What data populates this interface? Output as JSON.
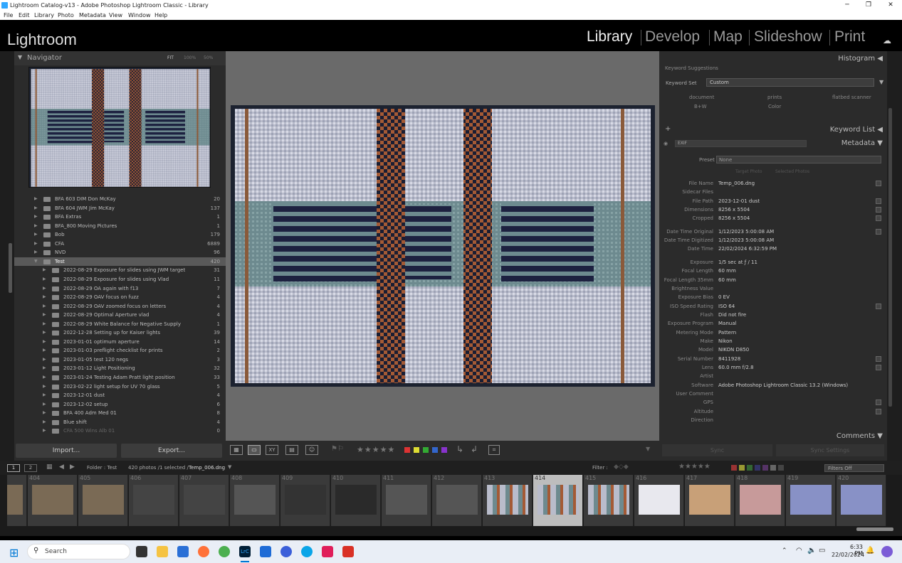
{
  "window": {
    "title": "Lightroom Catalog-v13 - Adobe Photoshop Lightroom Classic - Library"
  },
  "menu": [
    "File",
    "Edit",
    "Library",
    "Photo",
    "Metadata",
    "View",
    "Window",
    "Help"
  ],
  "app": {
    "logo": "Lightroom",
    "modules": [
      "Library",
      "Develop",
      "Map",
      "Slideshow",
      "Print"
    ],
    "active_module": "Library"
  },
  "navigator": {
    "title": "Navigator",
    "zoom_options": [
      "FIT",
      "100%",
      "50%"
    ]
  },
  "folders": [
    {
      "name": "BFA 603 DIM Don McKay",
      "count": "20",
      "level": 1
    },
    {
      "name": "BFA 604 JWM Jim McKay",
      "count": "137",
      "level": 1
    },
    {
      "name": "BFA Extras",
      "count": "1",
      "level": 1
    },
    {
      "name": "BFA_800 Moving Pictures",
      "count": "1",
      "level": 1
    },
    {
      "name": "Bob",
      "count": "179",
      "level": 1
    },
    {
      "name": "CFA",
      "count": "6889",
      "level": 1
    },
    {
      "name": "NVD",
      "count": "96",
      "level": 1
    },
    {
      "name": "Test",
      "count": "420",
      "level": 1,
      "selected": true
    },
    {
      "name": "2022-08-29 Exposure for slides using JWM target",
      "count": "31",
      "level": 2
    },
    {
      "name": "2022-08-29 Exposure for slides using Vlad",
      "count": "11",
      "level": 2
    },
    {
      "name": "2022-08-29 OA again with f13",
      "count": "7",
      "level": 2
    },
    {
      "name": "2022-08-29 OAV focus on fuzz",
      "count": "4",
      "level": 2
    },
    {
      "name": "2022-08-29 OAV zoomed focus on letters",
      "count": "4",
      "level": 2
    },
    {
      "name": "2022-08-29 Optimal Aperture vlad",
      "count": "4",
      "level": 2
    },
    {
      "name": "2022-08-29 White Balance for Negative Supply",
      "count": "1",
      "level": 2
    },
    {
      "name": "2022-12-28 Setting up for Kaiser lights",
      "count": "39",
      "level": 2
    },
    {
      "name": "2023-01-01 optimum aperture",
      "count": "14",
      "level": 2
    },
    {
      "name": "2023-01-03 preflight checklist for prints",
      "count": "2",
      "level": 2
    },
    {
      "name": "2023-01-05 test 120 negs",
      "count": "3",
      "level": 2
    },
    {
      "name": "2023-01-12 Light Positioning",
      "count": "32",
      "level": 2
    },
    {
      "name": "2023-01-24 Testing Adam Pratt light position",
      "count": "33",
      "level": 2
    },
    {
      "name": "2023-02-22 light setup for UV 70 glass",
      "count": "5",
      "level": 2
    },
    {
      "name": "2023-12-01 dust",
      "count": "4",
      "level": 2
    },
    {
      "name": "2023-12-02 setup",
      "count": "6",
      "level": 2
    },
    {
      "name": "BFA 400 Adm Med 01",
      "count": "8",
      "level": 2
    },
    {
      "name": "Blue shift",
      "count": "4",
      "level": 2
    },
    {
      "name": "CFA 500 Wins Alb 01",
      "count": "0",
      "level": 2,
      "dim": true
    }
  ],
  "left_buttons": {
    "import": "Import...",
    "export": "Export..."
  },
  "right_panel": {
    "histogram": "Histogram",
    "keyword_suggestions": "Keyword Suggestions",
    "keyword_set_label": "Keyword Set",
    "keyword_set_value": "Custom",
    "keywords": [
      "document",
      "prints",
      "flatbed scanner",
      "B+W",
      "Color"
    ],
    "keyword_list": "Keyword List",
    "metadata": "Metadata",
    "metadata_preset_source": "EXIF",
    "preset_label": "Preset",
    "preset_value": "None",
    "target_photo": "Target Photo",
    "selected_photos": "Selected Photos",
    "comments": "Comments",
    "sync": "Sync",
    "sync_settings": "Sync Settings"
  },
  "metadata_rows": [
    {
      "label": "File Name",
      "value": "Temp_006.dng",
      "edit": true
    },
    {
      "label": "Sidecar Files",
      "value": ""
    },
    {
      "label": "File Path",
      "value": "2023-12-01 dust",
      "edit": true
    },
    {
      "label": "Dimensions",
      "value": "8256 x 5504",
      "edit": true
    },
    {
      "label": "Cropped",
      "value": "8256 x 5504",
      "edit": true
    },
    {
      "gap": true
    },
    {
      "label": "Date Time Original",
      "value": "1/12/2023 5:00:08 AM",
      "edit": true
    },
    {
      "label": "Date Time Digitized",
      "value": "1/12/2023 5:00:08 AM"
    },
    {
      "label": "Date Time",
      "value": "22/02/2024 6:32:59 PM"
    },
    {
      "gap": true
    },
    {
      "label": "Exposure",
      "value": "1/5 sec at ƒ / 11"
    },
    {
      "label": "Focal Length",
      "value": "60 mm"
    },
    {
      "label": "Focal Length 35mm",
      "value": "60 mm"
    },
    {
      "label": "Brightness Value",
      "value": ""
    },
    {
      "label": "Exposure Bias",
      "value": "0 EV"
    },
    {
      "label": "ISO Speed Rating",
      "value": "ISO 64",
      "edit": true
    },
    {
      "label": "Flash",
      "value": "Did not fire"
    },
    {
      "label": "Exposure Program",
      "value": "Manual"
    },
    {
      "label": "Metering Mode",
      "value": "Pattern"
    },
    {
      "label": "Make",
      "value": "Nikon"
    },
    {
      "label": "Model",
      "value": "NIKON D850"
    },
    {
      "label": "Serial Number",
      "value": "8411928",
      "edit": true
    },
    {
      "label": "Lens",
      "value": "60.0 mm f/2.8",
      "edit": true
    },
    {
      "label": "Artist",
      "value": ""
    },
    {
      "label": "Software",
      "value": "Adobe Photoshop Lightroom Classic 13.2 (Windows)"
    },
    {
      "label": "User Comment",
      "value": ""
    },
    {
      "label": "GPS",
      "value": "",
      "edit": true
    },
    {
      "label": "Altitude",
      "value": "",
      "edit": true
    },
    {
      "label": "Direction",
      "value": ""
    }
  ],
  "filmbar": {
    "page1": "1",
    "page2": "2",
    "source": "Folder : Test",
    "count": "420 photos /1 selected /",
    "filename": "Temp_006.dng",
    "filter_label": "Filter :",
    "filters_off": "Filters Off"
  },
  "filmstrip": {
    "numbers": [
      "",
      "404",
      "405",
      "406",
      "407",
      "408",
      "409",
      "410",
      "411",
      "412",
      "413",
      "414",
      "415",
      "416",
      "417",
      "418",
      "419",
      "420"
    ],
    "selected": "414"
  },
  "taskbar": {
    "search": "Search",
    "time": "6:33 PM",
    "date": "22/02/2024"
  },
  "colors": {
    "panel": "#2b2b2b",
    "center": "#6a6a6a",
    "selected_cell": "#bdbdbd"
  }
}
